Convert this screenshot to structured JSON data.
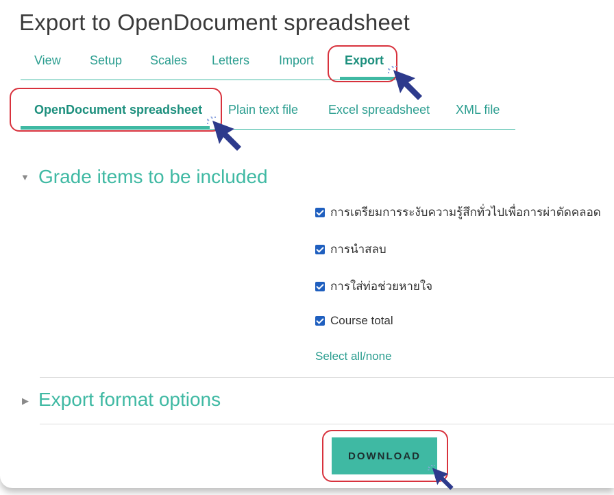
{
  "page": {
    "title": "Export to OpenDocument spreadsheet"
  },
  "main_tabs": [
    {
      "label": "View"
    },
    {
      "label": "Setup"
    },
    {
      "label": "Scales"
    },
    {
      "label": "Letters"
    },
    {
      "label": "Import"
    },
    {
      "label": "Export"
    }
  ],
  "export_tabs": [
    {
      "label": "OpenDocument spreadsheet"
    },
    {
      "label": "Plain text file"
    },
    {
      "label": "Excel spreadsheet"
    },
    {
      "label": "XML file"
    }
  ],
  "grade_items": {
    "heading": "Grade items to be included",
    "items": [
      {
        "label": "การเตรียมการระงับความรู้สึกทั่วไปเพื่อการผ่าตัดคลอด",
        "checked": true
      },
      {
        "label": "การนำสลบ",
        "checked": true
      },
      {
        "label": "การใส่ท่อช่วยหายใจ",
        "checked": true
      },
      {
        "label": "Course total",
        "checked": true
      }
    ],
    "select_all": "Select all/none"
  },
  "export_format": {
    "heading": "Export format options"
  },
  "actions": {
    "download": "DOWNLOAD"
  },
  "colors": {
    "accent": "#3fb9a3",
    "highlight": "#d8323d",
    "checkbox": "#1f5fbf",
    "pointer": "#2d3a8c"
  }
}
